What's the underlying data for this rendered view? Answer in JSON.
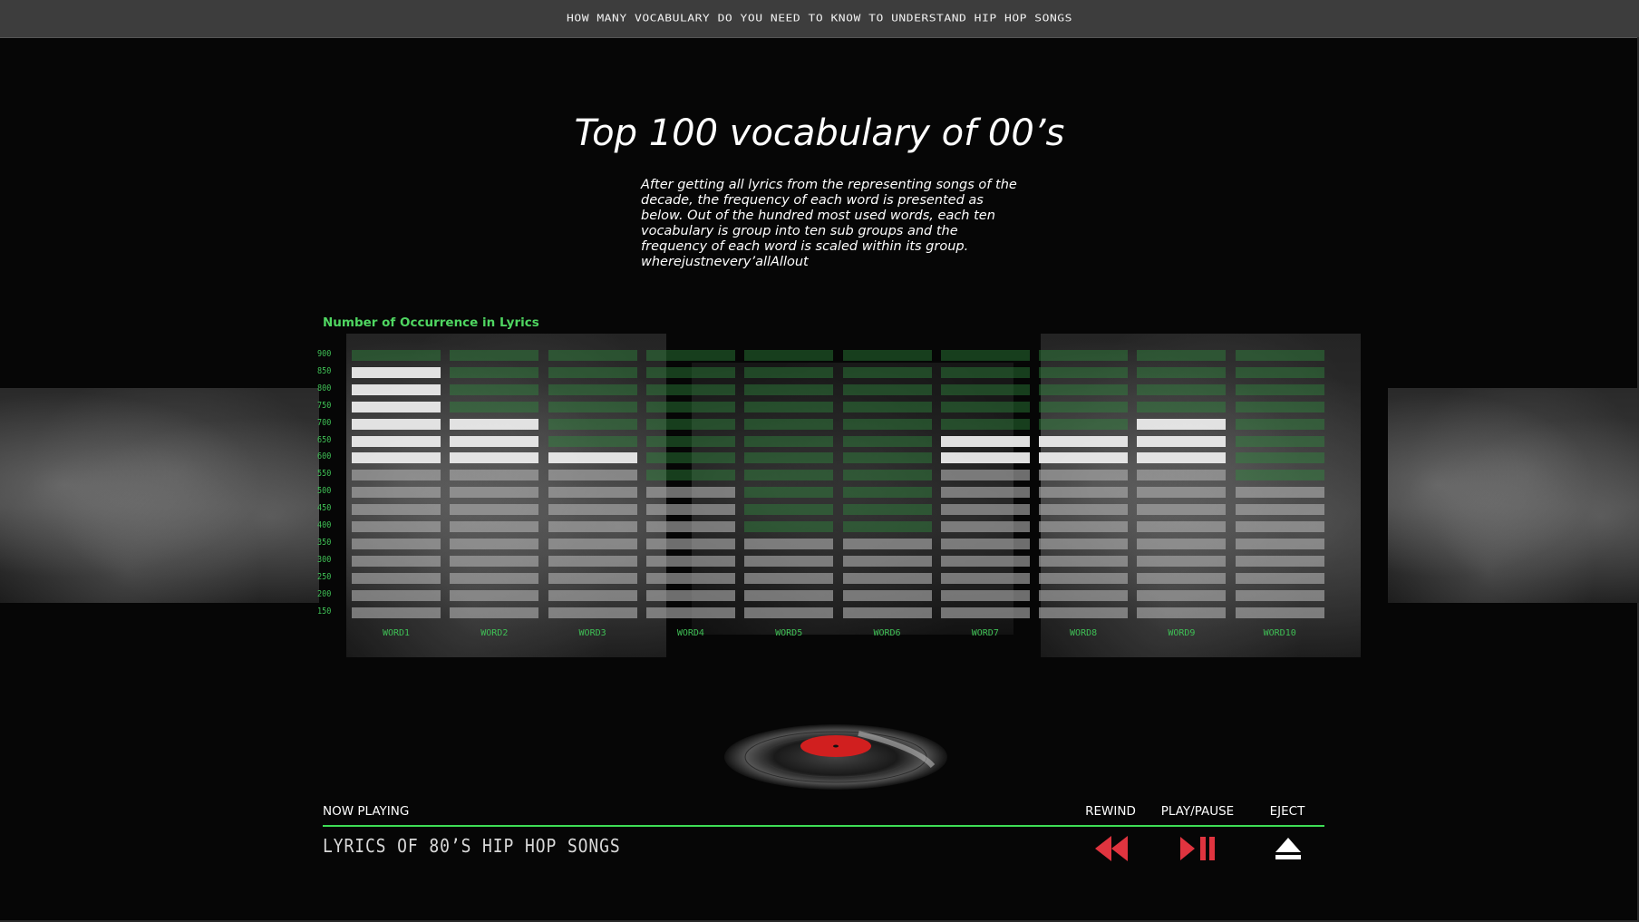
{
  "header": {
    "title": "How many vocabulary do you need to know to understand hip hop songs"
  },
  "main": {
    "title": "Top 100 vocabulary of 00’s",
    "description": " After getting all lyrics from the representing songs of the decade, the frequency of each word is presented as below. Out of the hundred most used words, each ten vocabulary is group into ten sub groups and the frequency of each word is scaled within its group.",
    "words_line": "wherejustnevery’allAllout"
  },
  "chart_data": {
    "type": "bar",
    "ylabel": "Number of Occurrence in Lyrics",
    "ylim": [
      150,
      900
    ],
    "yticks": [
      900,
      850,
      800,
      750,
      700,
      650,
      600,
      550,
      500,
      450,
      400,
      350,
      300,
      250,
      200,
      150
    ],
    "categories": [
      "word1",
      "word2",
      "word3",
      "word4",
      "word5",
      "word6",
      "word7",
      "word8",
      "word9",
      "word10"
    ],
    "values": [
      850,
      700,
      600,
      500,
      350,
      350,
      650,
      650,
      700,
      500
    ],
    "accent_color": "#3fbf55",
    "highlight_color": "#e6e6e6"
  },
  "player": {
    "now_playing_label": "NOW PLAYING",
    "track": "Lyrics of 80’s Hip Hop Songs",
    "rewind_label": "REWIND",
    "play_pause_label": "PLAY/PAUSE",
    "eject_label": "EJECT",
    "control_color": "#e0343f",
    "icons": {
      "rewind": "rewind-icon",
      "play_pause": "play-pause-icon",
      "eject": "eject-icon",
      "disc": "vinyl-record-icon"
    }
  }
}
